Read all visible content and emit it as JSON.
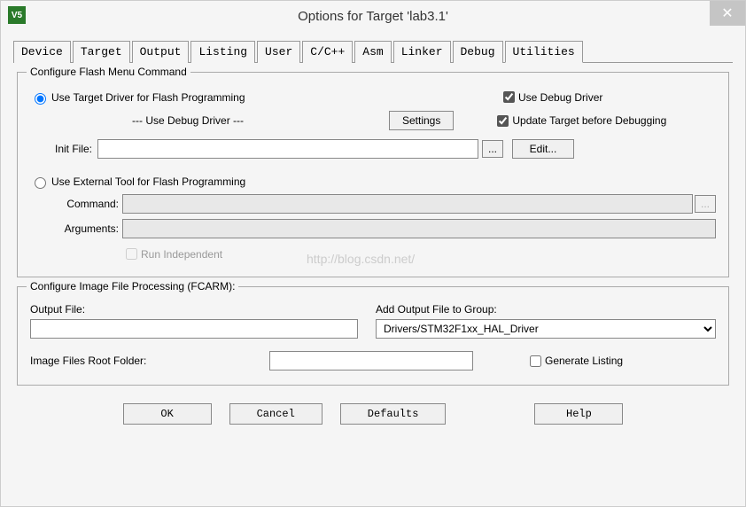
{
  "window": {
    "title": "Options for Target 'lab3.1'",
    "icon_text": "V5"
  },
  "tabs": [
    "Device",
    "Target",
    "Output",
    "Listing",
    "User",
    "C/C++",
    "Asm",
    "Linker",
    "Debug",
    "Utilities"
  ],
  "active_tab": "Utilities",
  "group1": {
    "title": "Configure Flash Menu Command",
    "radio1_label": "Use Target Driver for Flash Programming",
    "driver_label": "--- Use Debug Driver ---",
    "settings_btn": "Settings",
    "use_debug_driver": "Use Debug Driver",
    "update_target": "Update Target before Debugging",
    "init_file_label": "Init File:",
    "init_file_value": "",
    "edit_btn": "Edit...",
    "radio2_label": "Use External Tool for Flash Programming",
    "command_label": "Command:",
    "command_value": "",
    "arguments_label": "Arguments:",
    "arguments_value": "",
    "run_independent": "Run Independent"
  },
  "group2": {
    "title": "Configure Image File Processing (FCARM):",
    "output_file_label": "Output File:",
    "output_file_value": "",
    "add_output_label": "Add Output File to Group:",
    "group_select": "Drivers/STM32F1xx_HAL_Driver",
    "root_folder_label": "Image Files Root Folder:",
    "root_folder_value": "",
    "generate_listing": "Generate Listing"
  },
  "buttons": {
    "ok": "OK",
    "cancel": "Cancel",
    "defaults": "Defaults",
    "help": "Help"
  },
  "watermark": "http://blog.csdn.net/"
}
